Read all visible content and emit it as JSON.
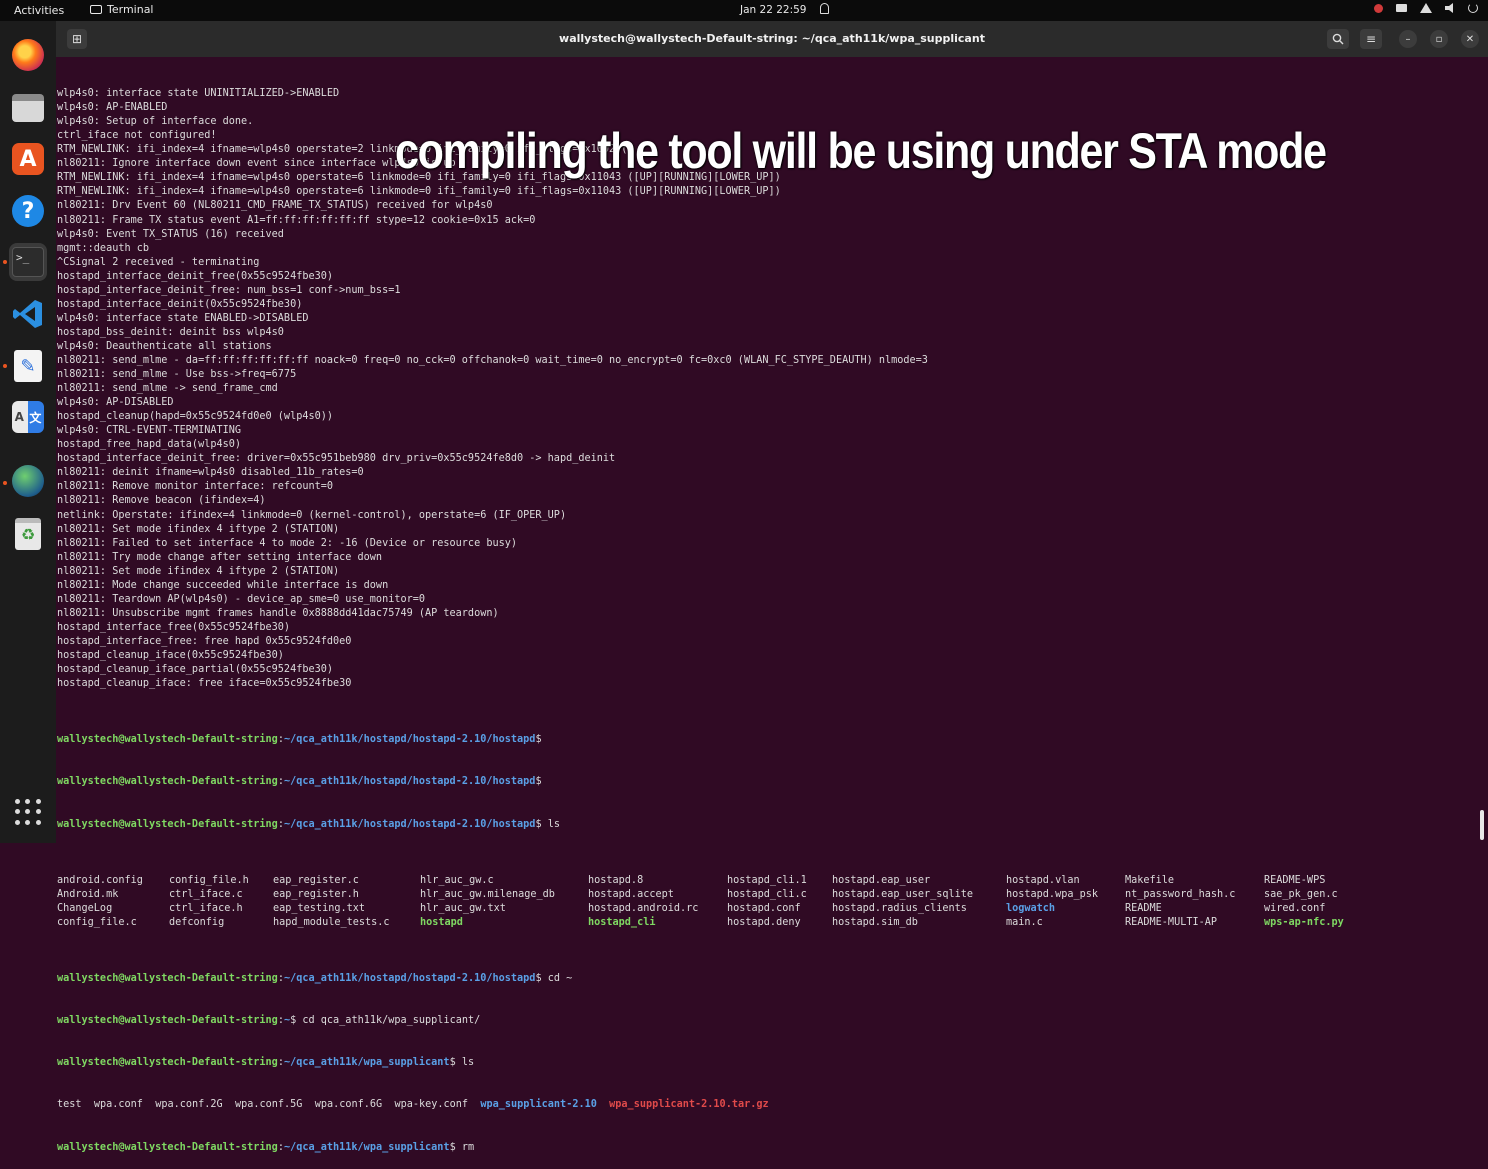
{
  "topbar": {
    "activities": "Activities",
    "app_name": "Terminal",
    "clock": "Jan 22  22:59"
  },
  "dock": {
    "items": [
      "firefox-icon",
      "files-icon",
      "app-store-icon",
      "help-icon",
      "terminal-icon",
      "vscode-icon",
      "text-editor-icon",
      "translate-icon",
      "globe-icon",
      "trash-icon",
      "show-apps-icon"
    ]
  },
  "window": {
    "title": "wallystech@wallystech-Default-string: ~/qca_ath11k/wpa_supplicant",
    "buttons": {
      "minimize": "–",
      "maximize": "▫",
      "close": "✕"
    }
  },
  "caption": "compiling the tool will be using under STA mode",
  "prompt": {
    "user": "wallystech@wallystech-Default-string",
    "path_hostapd": "~/qca_ath11k/hostapd/hostapd-2.10/hostapd",
    "path_wpa": "~/qca_ath11k/wpa_supplicant",
    "path_root": "~"
  },
  "log_lines": [
    "wlp4s0: interface state UNINITIALIZED->ENABLED",
    "wlp4s0: AP-ENABLED",
    "wlp4s0: Setup of interface done.",
    "ctrl_iface not configured!",
    "RTM_NEWLINK: ifi_index=4 ifname=wlp4s0 operstate=2 linkmode=0 ifi_family=0 ifi_flags=0x1002 ()",
    "nl80211: Ignore interface down event since interface wlp4s0 is up",
    "RTM_NEWLINK: ifi_index=4 ifname=wlp4s0 operstate=6 linkmode=0 ifi_family=0 ifi_flags=0x11043 ([UP][RUNNING][LOWER_UP])",
    "RTM_NEWLINK: ifi_index=4 ifname=wlp4s0 operstate=6 linkmode=0 ifi_family=0 ifi_flags=0x11043 ([UP][RUNNING][LOWER_UP])",
    "nl80211: Drv Event 60 (NL80211_CMD_FRAME_TX_STATUS) received for wlp4s0",
    "nl80211: Frame TX status event A1=ff:ff:ff:ff:ff:ff stype=12 cookie=0x15 ack=0",
    "wlp4s0: Event TX_STATUS (16) received",
    "mgmt::deauth cb",
    "^CSignal 2 received - terminating",
    "hostapd_interface_deinit_free(0x55c9524fbe30)",
    "hostapd_interface_deinit_free: num_bss=1 conf->num_bss=1",
    "hostapd_interface_deinit(0x55c9524fbe30)",
    "wlp4s0: interface state ENABLED->DISABLED",
    "hostapd_bss_deinit: deinit bss wlp4s0",
    "wlp4s0: Deauthenticate all stations",
    "nl80211: send_mlme - da=ff:ff:ff:ff:ff:ff noack=0 freq=0 no_cck=0 offchanok=0 wait_time=0 no_encrypt=0 fc=0xc0 (WLAN_FC_STYPE_DEAUTH) nlmode=3",
    "nl80211: send_mlme - Use bss->freq=6775",
    "nl80211: send_mlme -> send_frame_cmd",
    "wlp4s0: AP-DISABLED",
    "hostapd_cleanup(hapd=0x55c9524fd0e0 (wlp4s0))",
    "wlp4s0: CTRL-EVENT-TERMINATING",
    "hostapd_free_hapd_data(wlp4s0)",
    "hostapd_interface_deinit_free: driver=0x55c951beb980 drv_priv=0x55c9524fe8d0 -> hapd_deinit",
    "nl80211: deinit ifname=wlp4s0 disabled_11b_rates=0",
    "nl80211: Remove monitor interface: refcount=0",
    "nl80211: Remove beacon (ifindex=4)",
    "netlink: Operstate: ifindex=4 linkmode=0 (kernel-control), operstate=6 (IF_OPER_UP)",
    "nl80211: Set mode ifindex 4 iftype 2 (STATION)",
    "nl80211: Failed to set interface 4 to mode 2: -16 (Device or resource busy)",
    "nl80211: Try mode change after setting interface down",
    "nl80211: Set mode ifindex 4 iftype 2 (STATION)",
    "nl80211: Mode change succeeded while interface is down",
    "nl80211: Teardown AP(wlp4s0) - device_ap_sme=0 use_monitor=0",
    "nl80211: Unsubscribe mgmt frames handle 0x8888dd41dac75749 (AP teardown)",
    "hostapd_interface_free(0x55c9524fbe30)",
    "hostapd_interface_free: free hapd 0x55c9524fd0e0",
    "hostapd_cleanup_iface(0x55c9524fbe30)",
    "hostapd_cleanup_iface_partial(0x55c9524fbe30)",
    "hostapd_cleanup_iface: free iface=0x55c9524fbe30"
  ],
  "commands": {
    "ls": "ls",
    "cd_home": "cd ~",
    "cd_wpa": "cd qca_ath11k/wpa_supplicant/",
    "rm": "rm"
  },
  "ls_hostapd": {
    "col1": [
      "android.config",
      "Android.mk",
      "ChangeLog",
      "config_file.c"
    ],
    "col2": [
      "config_file.h",
      "ctrl_iface.c",
      "ctrl_iface.h",
      "defconfig"
    ],
    "col3": [
      "eap_register.c",
      "eap_register.h",
      "eap_testing.txt",
      "hapd_module_tests.c"
    ],
    "col4": [
      "hlr_auc_gw.c",
      "hlr_auc_gw.milenage_db",
      "hlr_auc_gw.txt",
      "hostapd"
    ],
    "col5": [
      "hostapd.8",
      "hostapd.accept",
      "hostapd.android.rc",
      "hostapd_cli"
    ],
    "col6": [
      "hostapd_cli.1",
      "hostapd_cli.c",
      "hostapd.conf",
      "hostapd.deny"
    ],
    "col7": [
      "hostapd.eap_user",
      "hostapd.eap_user_sqlite",
      "hostapd.radius_clients",
      "hostapd.sim_db"
    ],
    "col8": [
      "hostapd.vlan",
      "hostapd.wpa_psk",
      "logwatch",
      "main.c"
    ],
    "col9": [
      "Makefile",
      "nt_password_hash.c",
      "README",
      "README-MULTI-AP"
    ],
    "col10": [
      "README-WPS",
      "sae_pk_gen.c",
      "wired.conf",
      "wps-ap-nfc.py"
    ]
  },
  "ls_wpa": {
    "files": [
      "test",
      "wpa.conf",
      "wpa.conf.2G",
      "wpa.conf.5G",
      "wpa.conf.6G",
      "wpa-key.conf"
    ],
    "dir": "wpa_supplicant-2.10",
    "archive": "wpa_supplicant-2.10.tar.gz"
  }
}
